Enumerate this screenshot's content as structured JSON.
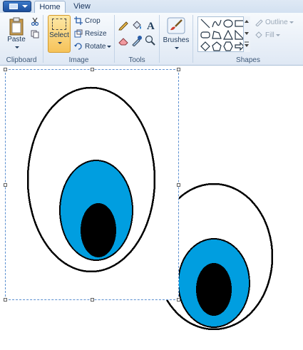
{
  "tabs": {
    "home": "Home",
    "view": "View"
  },
  "clipboard": {
    "paste": "Paste",
    "label": "Clipboard"
  },
  "image": {
    "select": "Select",
    "crop": "Crop",
    "resize": "Resize",
    "rotate": "Rotate",
    "label": "Image"
  },
  "tools": {
    "label": "Tools"
  },
  "brushes": {
    "label": "Brushes"
  },
  "shapes": {
    "outline": "Outline",
    "fill": "Fill",
    "label": "Shapes"
  },
  "colors": {
    "accent": "#009ee0",
    "iris": "#1e9ae0",
    "pupil": "#000000",
    "outline": "#000000"
  }
}
